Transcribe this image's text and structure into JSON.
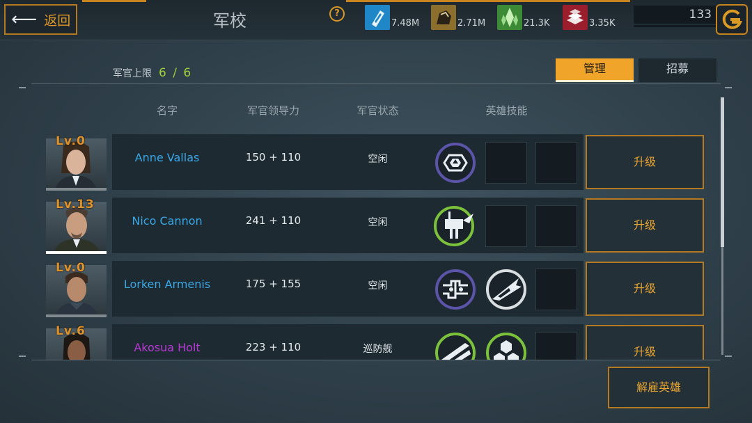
{
  "header": {
    "back_label": "返回",
    "title": "军校",
    "help_label": "?"
  },
  "resources": [
    {
      "name": "blue-resource",
      "icon": "blue-crystal-icon",
      "color": "#1f86c7",
      "value": "7.48M"
    },
    {
      "name": "ore-resource",
      "icon": "ore-rock-icon",
      "color": "#8c6f2c",
      "value": "2.71M"
    },
    {
      "name": "crystal-resource",
      "icon": "green-crystal-icon",
      "color": "#3c8a36",
      "value": "21.3K"
    },
    {
      "name": "alloy-resource",
      "icon": "alloy-bars-icon",
      "color": "#9a1e2c",
      "value": "3.35K"
    }
  ],
  "currency": {
    "value": "133",
    "icon": "gold-coin-icon",
    "color": "#d99a25"
  },
  "summary": {
    "officer_cap_label": "军官上限",
    "officer_cap_value": "6 / 6"
  },
  "tabs": [
    {
      "label": "管理",
      "active": true
    },
    {
      "label": "招募",
      "active": false
    }
  ],
  "columns": {
    "name": "名字",
    "leadership": "军官领导力",
    "status": "军官状态",
    "skills": "英雄技能"
  },
  "officers": [
    {
      "level": "Lv.0",
      "name": "Anne Vallas",
      "name_color": "#39a7e6",
      "leadership": "150 + 110",
      "status": "空闲",
      "skills": [
        "hex-shield-skill-icon"
      ],
      "upgrade_label": "升级"
    },
    {
      "level": "Lv.13",
      "name": "Nico Cannon",
      "name_color": "#39a7e6",
      "leadership": "241 + 110",
      "status": "空闲",
      "skills": [
        "turret-skill-icon"
      ],
      "upgrade_label": "升级"
    },
    {
      "level": "Lv.0",
      "name": "Lorken Armenis",
      "name_color": "#39a7e6",
      "leadership": "175 + 155",
      "status": "空闲",
      "skills": [
        "circuit-skill-icon",
        "fighter-ship-skill-icon"
      ],
      "upgrade_label": "升级"
    },
    {
      "level": "Lv.6",
      "name": "Akosua Holt",
      "name_color": "#b93ad6",
      "leadership": "223 + 110",
      "status": "巡防舰",
      "skills": [
        "missile-skill-icon",
        "hex-armor-skill-icon"
      ],
      "upgrade_label": "升级"
    }
  ],
  "footer": {
    "dismiss_label": "解雇英雄"
  }
}
